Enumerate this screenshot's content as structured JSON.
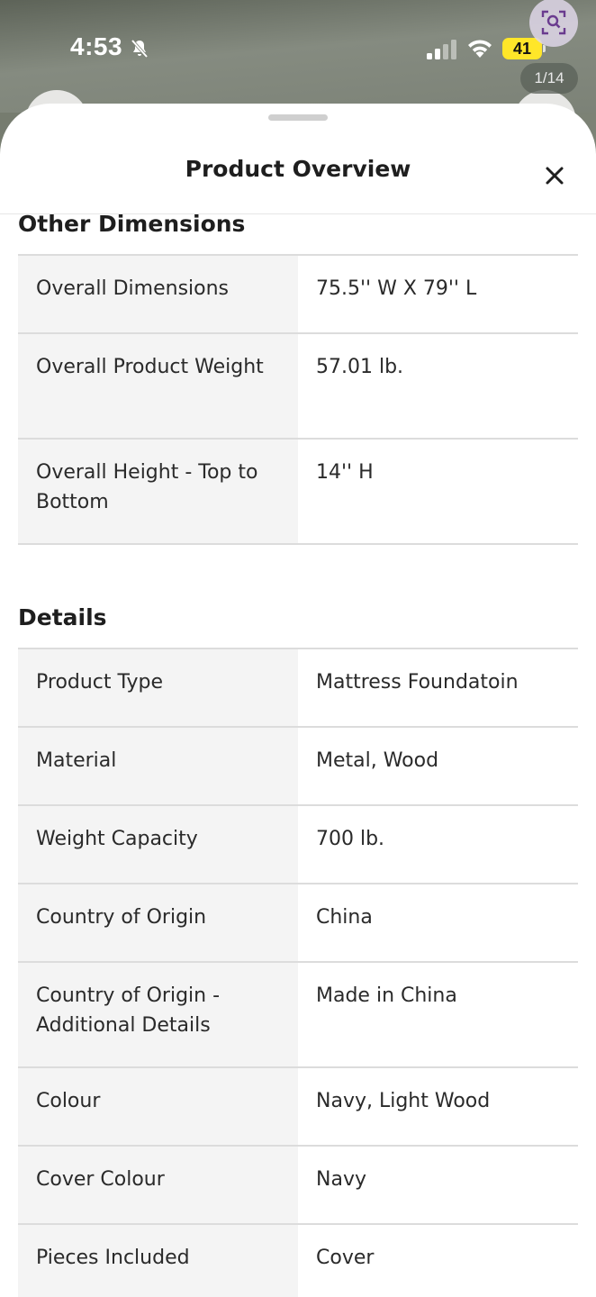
{
  "status_bar": {
    "time": "4:53",
    "battery_level": "41",
    "battery_color": "#ffe629"
  },
  "gallery": {
    "counter": "1/14"
  },
  "sheet": {
    "title": "Product Overview",
    "close_icon": "close-icon"
  },
  "other_dimensions": {
    "heading": "Other Dimensions",
    "rows": [
      {
        "label": "Overall Dimensions",
        "value": "75.5'' W X 79'' L"
      },
      {
        "label": "Overall Product Weight",
        "value": "57.01 lb."
      },
      {
        "label": "Overall Height - Top to Bottom",
        "value": "14'' H"
      }
    ]
  },
  "details": {
    "heading": "Details",
    "rows": [
      {
        "label": "Product Type",
        "value": "Mattress Foundatoin"
      },
      {
        "label": "Material",
        "value": "Metal, Wood"
      },
      {
        "label": "Weight Capacity",
        "value": "700 lb."
      },
      {
        "label": "Country of Origin",
        "value": "China"
      },
      {
        "label": "Country of Origin - Additional Details",
        "value": "Made in China"
      },
      {
        "label": "Colour",
        "value": "Navy, Light Wood"
      },
      {
        "label": "Cover Colour",
        "value": "Navy"
      },
      {
        "label": "Pieces Included",
        "value": "Cover"
      }
    ]
  }
}
